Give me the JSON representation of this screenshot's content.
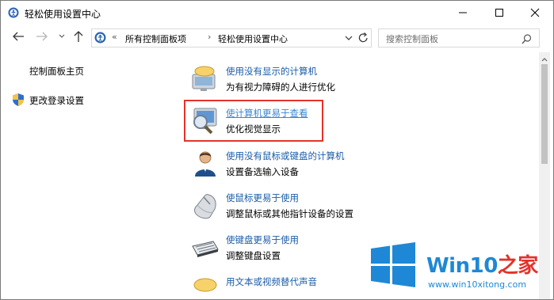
{
  "window": {
    "title": "轻松使用设置中心",
    "controls": [
      "minimize-icon",
      "maximize-icon",
      "close-icon"
    ]
  },
  "address_bar": {
    "overflow": "«",
    "segments": [
      "所有控制面板项",
      "轻松使用设置中心"
    ],
    "separator": "›"
  },
  "search": {
    "placeholder": "搜索控制面板"
  },
  "left_pane": {
    "home_link": "控制面板主页",
    "change_login_link": "更改登录设置"
  },
  "items": [
    {
      "title": "使用没有显示的计算机",
      "description": "为有视力障碍的人进行优化",
      "icon": "speech-bubble-monitor-icon"
    },
    {
      "title": "使计算机更易于查看",
      "description": "优化视觉显示",
      "icon": "magnifier-monitor-icon",
      "highlighted": true
    },
    {
      "title": "使用没有鼠标或键盘的计算机",
      "description": "设置备选输入设备",
      "icon": "person-icon"
    },
    {
      "title": "使鼠标更易于使用",
      "description": "调整鼠标或其他指针设备的设置",
      "icon": "mouse-icon"
    },
    {
      "title": "使键盘更易于使用",
      "description": "调整键盘设置",
      "icon": "keyboard-icon"
    },
    {
      "title": "用文本或视频替代声音",
      "description": "",
      "icon": "speech-bubble-icon"
    }
  ],
  "watermark": {
    "brand_prefix": "Win10",
    "brand_suffix": "之家",
    "url": "www.win10xitong.com"
  },
  "colors": {
    "link": "#1a5ca8",
    "highlight_box": "#e5332a",
    "watermark_blue": "#1e88d6",
    "watermark_red": "#e4322b"
  }
}
